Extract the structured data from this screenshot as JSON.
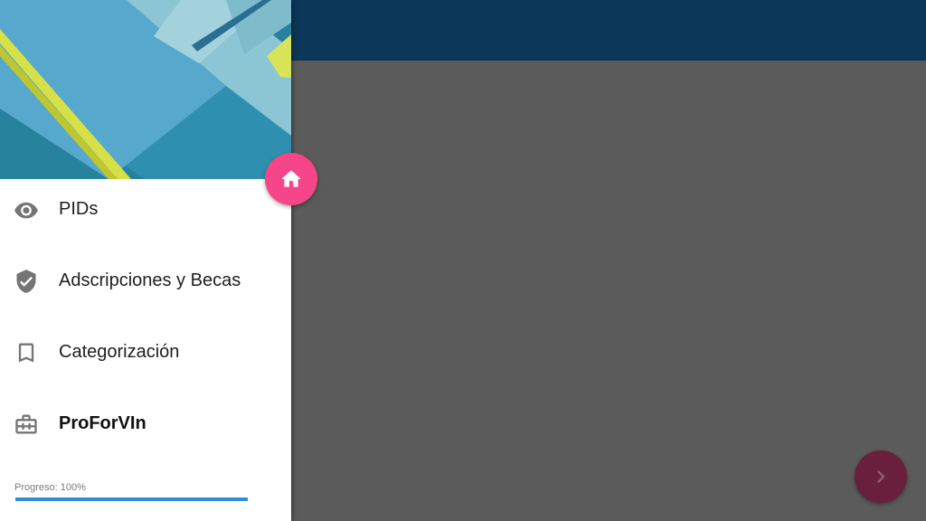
{
  "colors": {
    "topbar": "#0c3758",
    "scrim": "#5b5b5b",
    "drawer_bg": "#ffffff",
    "accent_fab": "#f7458a",
    "next_fab": "#6a1f3d",
    "progress": "#2f8fdd",
    "icon": "#757575"
  },
  "drawer": {
    "items": [
      {
        "label": "PIDs",
        "icon": "eye-icon",
        "active": false
      },
      {
        "label": "Adscripciones y Becas",
        "icon": "verified-shield-icon",
        "active": false
      },
      {
        "label": "Categorización",
        "icon": "bookmark-icon",
        "active": false
      },
      {
        "label": "ProForVIn",
        "icon": "briefcase-icon",
        "active": true
      }
    ],
    "progress": {
      "label": "Progreso: 100%",
      "value": 1.0
    }
  },
  "fab": {
    "home_icon": "home-icon",
    "next_icon": "chevron-right-icon"
  }
}
